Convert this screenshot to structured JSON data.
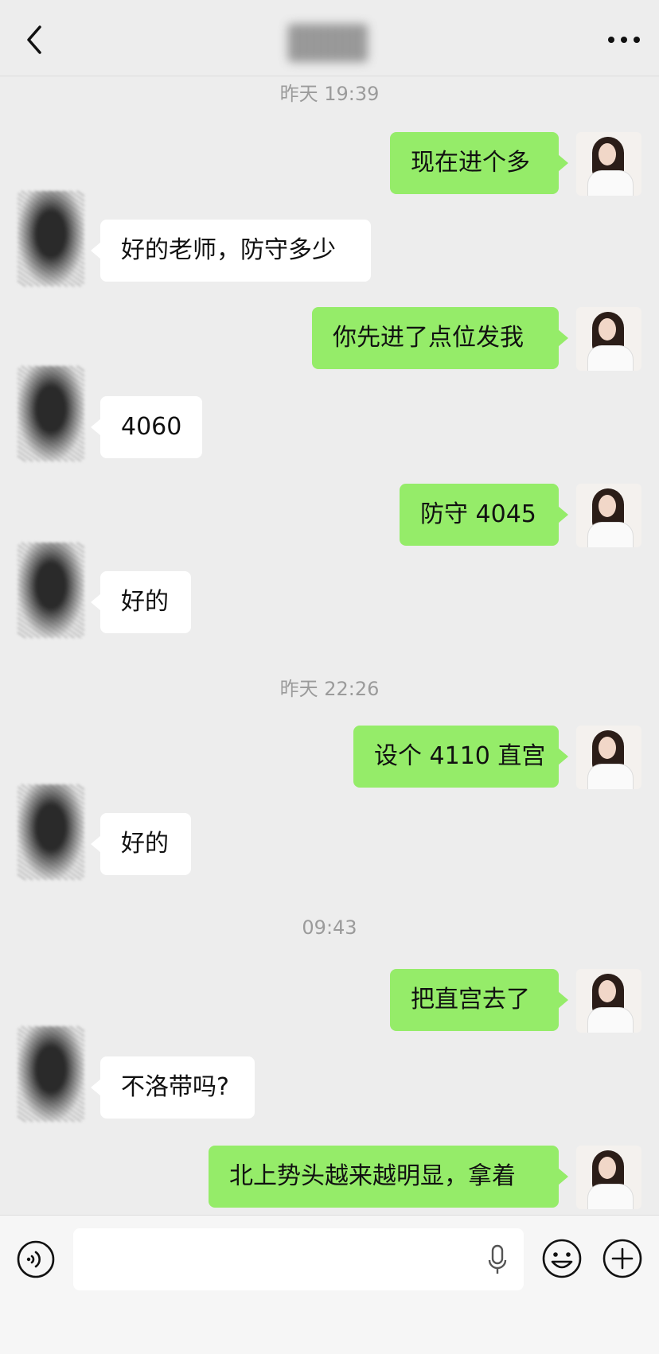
{
  "header": {
    "back_icon": "chevron-left-icon",
    "title": "",
    "more_icon": "more-horizontal-icon"
  },
  "messages": [
    {
      "kind": "time",
      "text": "昨天 19:39"
    },
    {
      "kind": "me",
      "text": "现在进个多"
    },
    {
      "kind": "other",
      "text": "好的老师，防守多少"
    },
    {
      "kind": "me",
      "text": "你先进了点位发我"
    },
    {
      "kind": "other",
      "text": "4060"
    },
    {
      "kind": "me",
      "text": "防守 4045"
    },
    {
      "kind": "other",
      "text": "好的"
    },
    {
      "kind": "time",
      "text": "昨天 22:26"
    },
    {
      "kind": "me",
      "text": "设个 4110 直宫"
    },
    {
      "kind": "other",
      "text": "好的"
    },
    {
      "kind": "time",
      "text": "09:43"
    },
    {
      "kind": "me",
      "text": "把直宫去了"
    },
    {
      "kind": "other",
      "text": "不洛带吗?"
    },
    {
      "kind": "me",
      "text": "北上势头越来越明显，拿着"
    }
  ],
  "footer": {
    "voice_icon": "voice-icon",
    "input_value": "",
    "mic_icon": "microphone-icon",
    "emoji_icon": "emoji-icon",
    "plus_icon": "plus-icon"
  },
  "colors": {
    "background": "#ededed",
    "my_bubble": "#95ec69",
    "other_bubble": "#ffffff",
    "timestamp": "#9b9b9b"
  }
}
